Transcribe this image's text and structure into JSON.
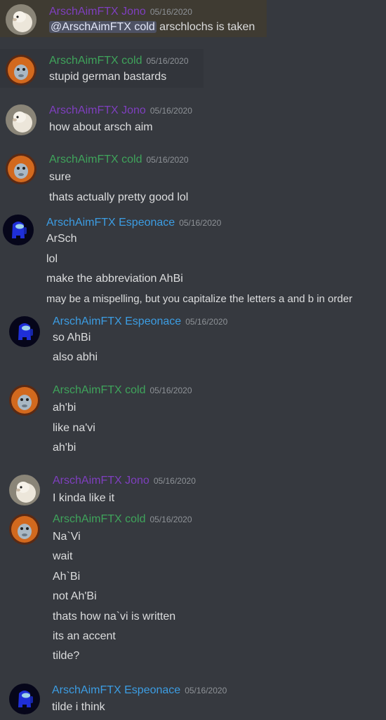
{
  "colors": {
    "jono": "#7f3fbf",
    "cold": "#3fa45b",
    "espeonace": "#3c9de3"
  },
  "messages": [
    {
      "author": "ArschAimFTX Jono",
      "time": "05/16/2020",
      "mention": "@ArschAimFTX cold",
      "lines": [
        "arschlochs is taken"
      ]
    },
    {
      "author": "ArschAimFTX cold",
      "time": "05/16/2020",
      "lines": [
        "stupid german bastards"
      ]
    },
    {
      "author": "ArschAimFTX Jono",
      "time": "05/16/2020",
      "lines": [
        "how about arsch aim"
      ]
    },
    {
      "author": "ArschAimFTX cold",
      "time": "05/16/2020",
      "lines": [
        "sure",
        "thats actually pretty good lol"
      ]
    },
    {
      "author": "ArschAimFTX Espeonace",
      "time": "05/16/2020",
      "lines": [
        "ArSch",
        "lol",
        "make the abbreviation AhBi",
        "may be a mispelling, but you capitalize the letters a and b in order"
      ]
    },
    {
      "author": "ArschAimFTX Espeonace",
      "time": "05/16/2020",
      "lines": [
        "so AhBi",
        "also abhi"
      ]
    },
    {
      "author": "ArschAimFTX cold",
      "time": "05/16/2020",
      "lines": [
        "ah'bi",
        "like na'vi",
        "ah'bi"
      ]
    },
    {
      "author": "ArschAimFTX Jono",
      "time": "05/16/2020",
      "lines": [
        "I kinda like it"
      ]
    },
    {
      "author": "ArschAimFTX cold",
      "time": "05/16/2020",
      "lines": [
        "Na`Vi",
        "wait",
        "Ah`Bi",
        "not Ah'Bi",
        "thats how na`vi is written",
        "its an accent",
        "tilde?"
      ]
    },
    {
      "author": "ArschAimFTX Espeonace",
      "time": "05/16/2020",
      "lines": [
        "tilde i think"
      ]
    }
  ]
}
